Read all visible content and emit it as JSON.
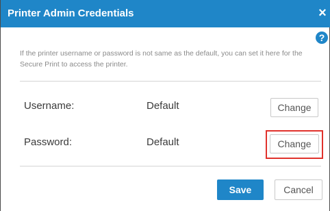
{
  "dialog": {
    "title": "Printer Admin Credentials",
    "close_icon": "×",
    "help_icon": "?",
    "info_text": "If the printer username or password is not same as the default, you can set it here for the Secure Print to access the printer.",
    "rows": [
      {
        "label": "Username:",
        "value": "Default",
        "button": "Change"
      },
      {
        "label": "Password:",
        "value": "Default",
        "button": "Change"
      }
    ],
    "save_label": "Save",
    "cancel_label": "Cancel"
  },
  "colors": {
    "accent": "#1f86c8",
    "highlight_border": "#e0312b"
  },
  "icons": [
    "close-icon",
    "help-icon"
  ]
}
